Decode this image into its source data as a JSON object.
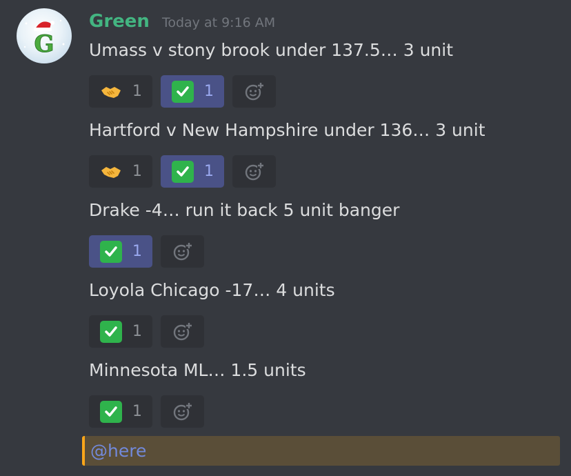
{
  "author": {
    "name": "Green",
    "timestamp": "Today at 9:16 AM",
    "avatar_letter": "G"
  },
  "messages": [
    {
      "text": "Umass v stony brook under 137.5… 3 unit",
      "reactions": [
        {
          "emoji": "handshake-emoji",
          "count": "1",
          "me": false
        },
        {
          "emoji": "check-mark-emoji",
          "count": "1",
          "me": true
        }
      ]
    },
    {
      "text": "Hartford v New Hampshire under 136… 3 unit",
      "reactions": [
        {
          "emoji": "handshake-emoji",
          "count": "1",
          "me": false
        },
        {
          "emoji": "check-mark-emoji",
          "count": "1",
          "me": true
        }
      ]
    },
    {
      "text": "Drake -4… run it back 5 unit banger",
      "reactions": [
        {
          "emoji": "check-mark-emoji",
          "count": "1",
          "me": true
        }
      ]
    },
    {
      "text": "Loyola Chicago -17… 4 units",
      "reactions": [
        {
          "emoji": "check-mark-emoji",
          "count": "1",
          "me": false
        }
      ]
    },
    {
      "text": "Minnesota ML… 1.5 units",
      "reactions": [
        {
          "emoji": "check-mark-emoji",
          "count": "1",
          "me": false
        }
      ]
    }
  ],
  "mention": "@here",
  "colors": {
    "background": "#36393f",
    "username": "#43b581",
    "reaction_me": "#4a5287",
    "mention_bar": "#faa61a",
    "mention_bg": "#5a4e38",
    "mention_text": "#7289da"
  }
}
